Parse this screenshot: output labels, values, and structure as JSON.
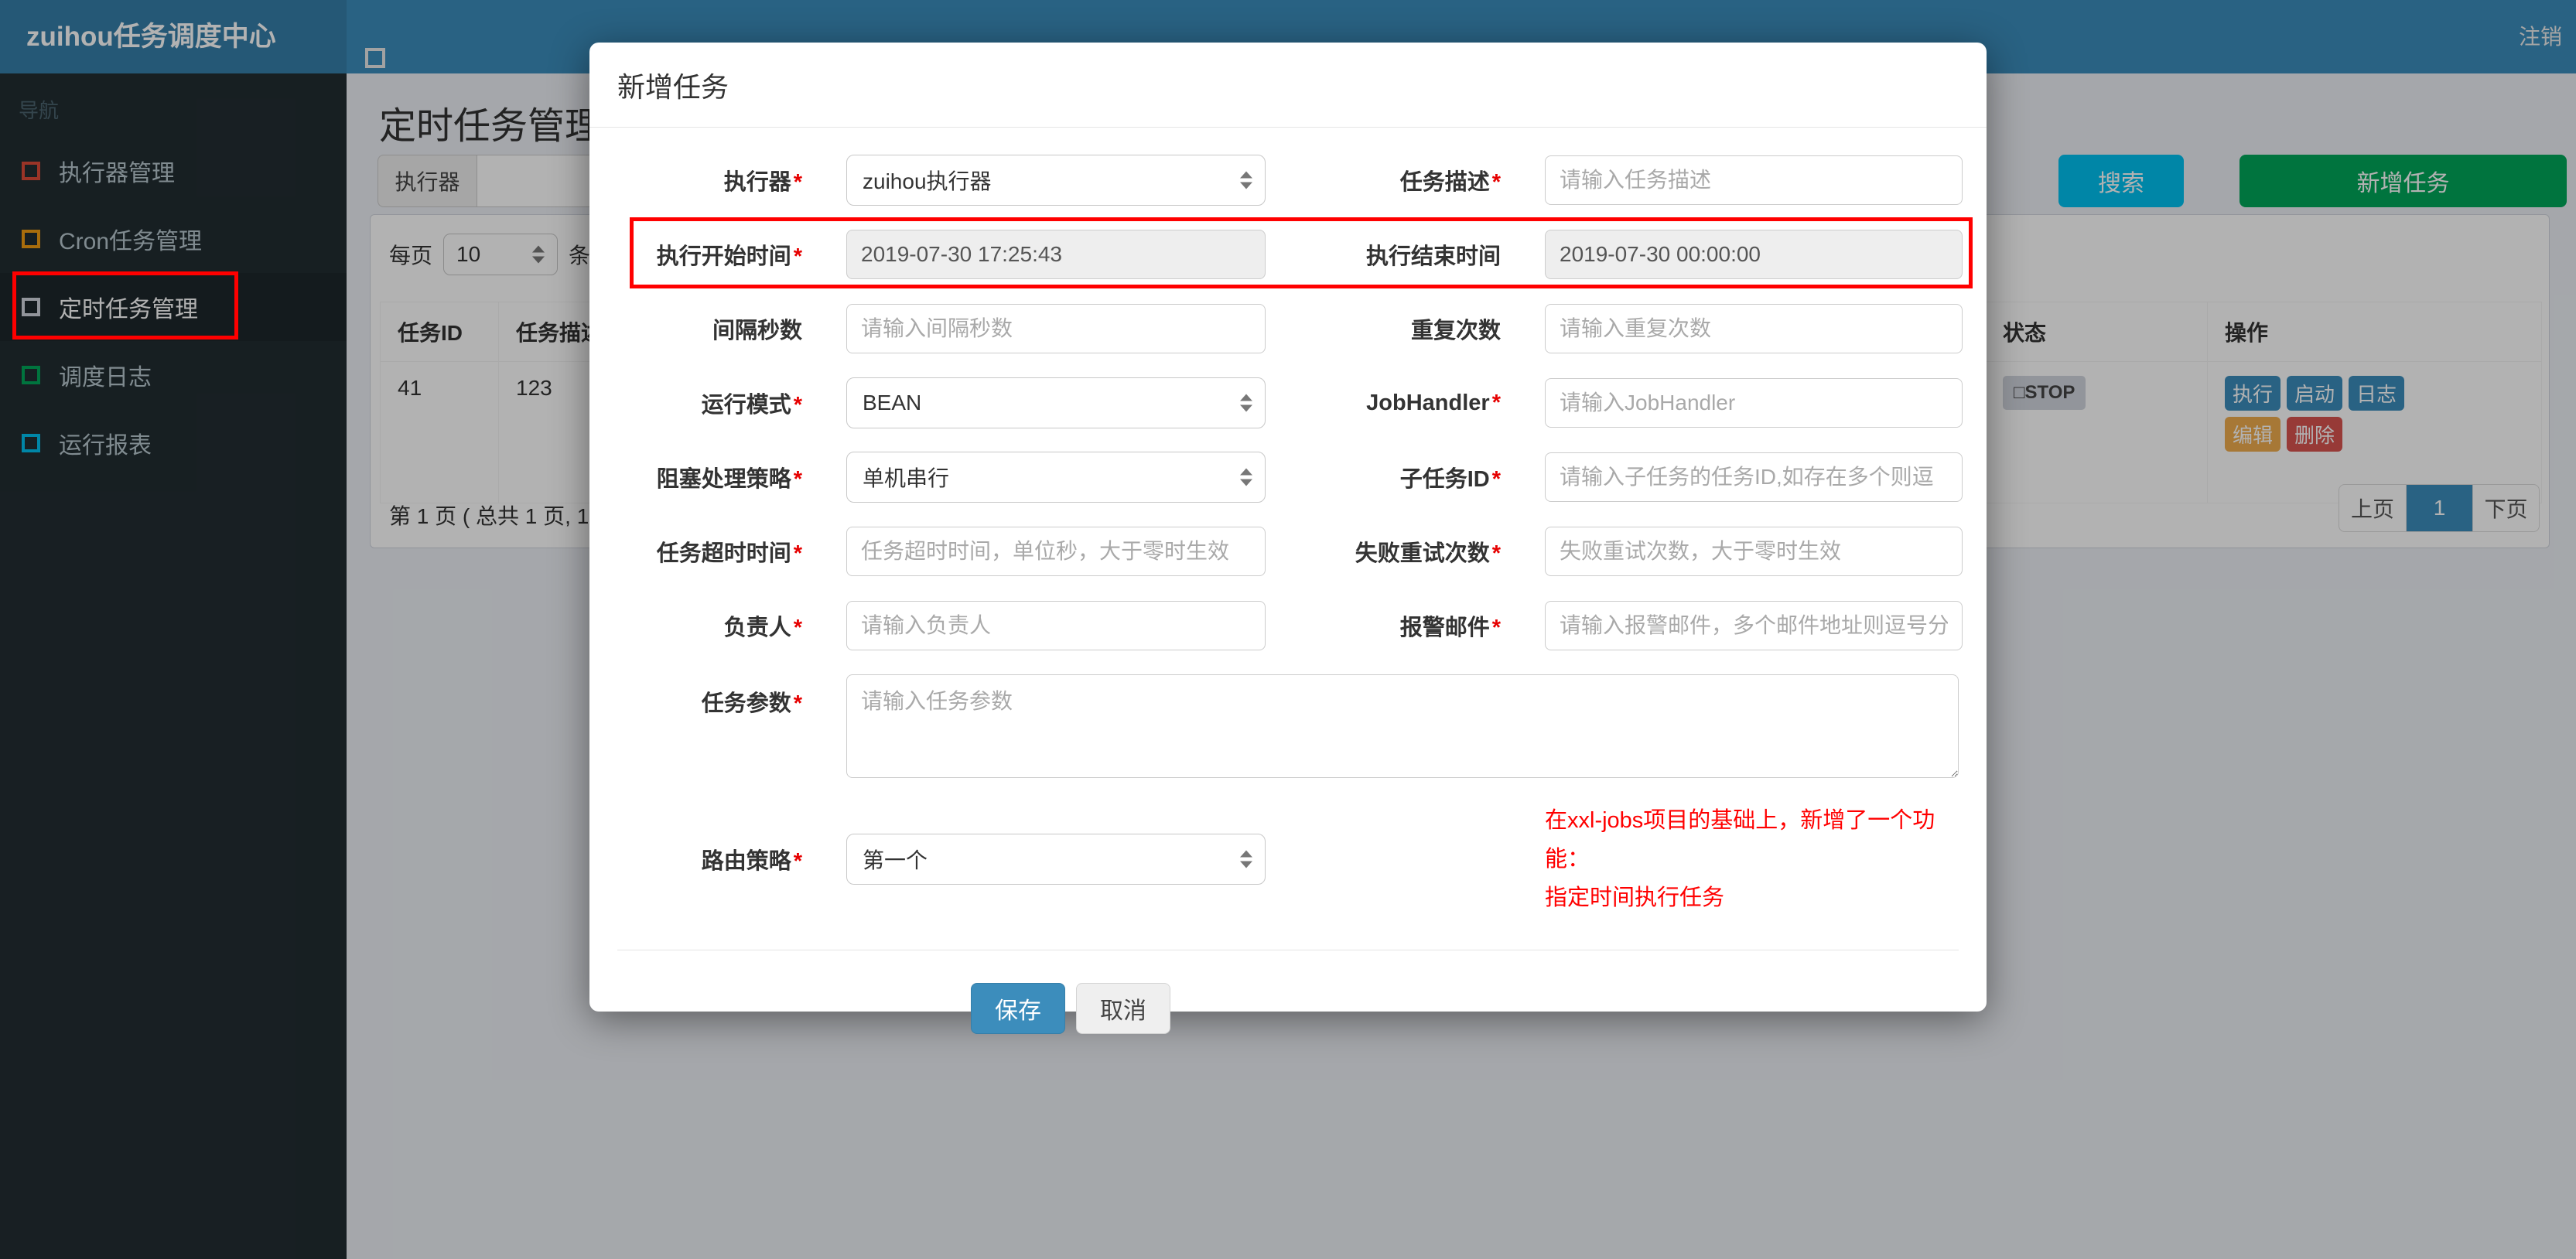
{
  "navbar": {
    "brand": "zuihou任务调度中心",
    "logout": "注销"
  },
  "sidebar": {
    "header": "导航",
    "items": [
      {
        "label": "执行器管理",
        "icon_color": "#dd4b39",
        "active": false
      },
      {
        "label": "Cron任务管理",
        "icon_color": "#f39c12",
        "active": false
      },
      {
        "label": "定时任务管理",
        "icon_color": "#d2d6de",
        "active": true
      },
      {
        "label": "调度日志",
        "icon_color": "#00a65a",
        "active": false
      },
      {
        "label": "运行报表",
        "icon_color": "#00c0ef",
        "active": false
      }
    ]
  },
  "page": {
    "title": "定时任务管理",
    "toolbar": {
      "executor_label": "执行器",
      "search_label": "搜索",
      "add_label": "新增任务"
    },
    "perpage": {
      "prefix": "每页",
      "value": "10",
      "suffix": "条记"
    },
    "table": {
      "headers": {
        "id": "任务ID",
        "desc": "任务描述",
        "status": "状态",
        "ops": "操作"
      },
      "row": {
        "id": "41",
        "desc": "123",
        "status": "□STOP",
        "actions": {
          "run": "执行",
          "start": "启动",
          "log": "日志",
          "edit": "编辑",
          "del": "删除"
        }
      }
    },
    "pagination": {
      "summary": "第 1 页 ( 总共 1 页, 1",
      "prev": "上页",
      "page": "1",
      "next": "下页"
    }
  },
  "modal": {
    "title": "新增任务",
    "required_marker": "*",
    "fields": {
      "executor": {
        "label": "执行器",
        "value": "zuihou执行器"
      },
      "desc": {
        "label": "任务描述",
        "placeholder": "请输入任务描述"
      },
      "start": {
        "label": "执行开始时间",
        "value": "2019-07-30 17:25:43"
      },
      "end": {
        "label": "执行结束时间",
        "value": "2019-07-30 00:00:00"
      },
      "interval": {
        "label": "间隔秒数",
        "placeholder": "请输入间隔秒数"
      },
      "repeat": {
        "label": "重复次数",
        "placeholder": "请输入重复次数"
      },
      "mode": {
        "label": "运行模式",
        "value": "BEAN"
      },
      "handler": {
        "label": "JobHandler",
        "placeholder": "请输入JobHandler"
      },
      "block": {
        "label": "阻塞处理策略",
        "value": "单机串行"
      },
      "child": {
        "label": "子任务ID",
        "placeholder": "请输入子任务的任务ID,如存在多个则逗"
      },
      "timeout": {
        "label": "任务超时时间",
        "placeholder": "任务超时时间，单位秒，大于零时生效"
      },
      "retry": {
        "label": "失败重试次数",
        "placeholder": "失败重试次数，大于零时生效"
      },
      "owner": {
        "label": "负责人",
        "placeholder": "请输入负责人"
      },
      "email": {
        "label": "报警邮件",
        "placeholder": "请输入报警邮件，多个邮件地址则逗号分"
      },
      "params": {
        "label": "任务参数",
        "placeholder": "请输入任务参数"
      },
      "route": {
        "label": "路由策略",
        "value": "第一个"
      }
    },
    "remark": {
      "line1": "在xxl-jobs项目的基础上，新增了一个功能：",
      "line2": "指定时间执行任务"
    },
    "save_label": "保存",
    "cancel_label": "取消"
  },
  "colors": {
    "navbar": "#3c8dbc",
    "brand": "#367fa9",
    "sidebar": "#222d32",
    "content_bg": "#ecf0f5",
    "primary": "#3c8dbc",
    "info": "#00c0ef",
    "success": "#00a65a",
    "warning": "#f0ad4e",
    "danger": "#d9534f",
    "annotation_red": "#ff0000",
    "status_badge_bg": "#d2d6de"
  }
}
